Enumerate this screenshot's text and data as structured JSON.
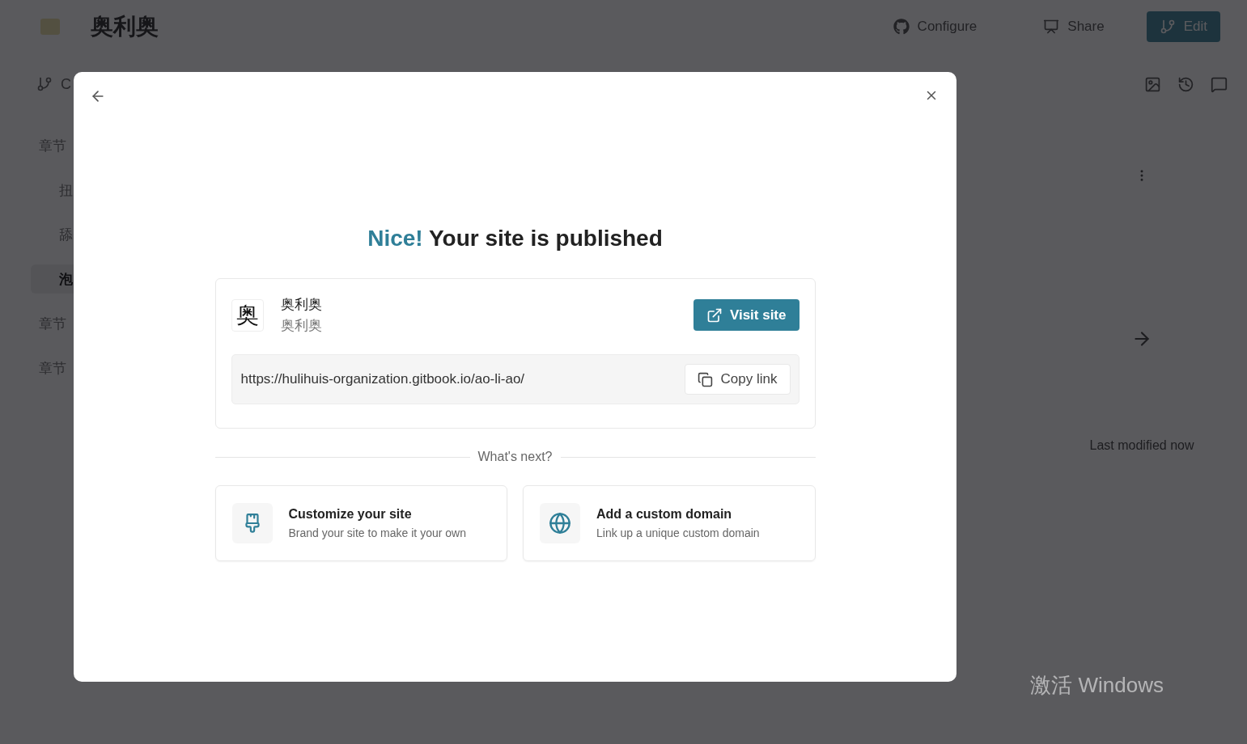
{
  "header": {
    "title": "奥利奥",
    "actions": [
      {
        "kind": "github",
        "label": "Configure"
      },
      {
        "kind": "share",
        "label": "Share"
      },
      {
        "kind": "primary",
        "label": "Edit"
      }
    ]
  },
  "branch": {
    "label": "C"
  },
  "sidebar": {
    "items": [
      {
        "label": "章节",
        "selected": false,
        "children": [
          {
            "label": "扭",
            "selected": false
          },
          {
            "label": "舔",
            "selected": false
          },
          {
            "label": "泡",
            "selected": true
          }
        ]
      },
      {
        "label": "章节",
        "selected": false
      },
      {
        "label": "章节",
        "selected": false
      }
    ]
  },
  "page": {
    "last_modified": "Last modified now"
  },
  "dialog": {
    "title_accent": "Nice!",
    "title": "Your site is published",
    "site": {
      "icon_char": "奥",
      "name": "奥利奥",
      "subtitle": "奥利奥",
      "visit_button": "Visit site",
      "url": "https://hulihuis-organization.gitbook.io/ao-li-ao/",
      "copy_button": "Copy link"
    },
    "next_heading": "What's next?",
    "next_steps": [
      {
        "kind": "customize",
        "title": "Customize your site",
        "description": "Brand your site to make it your own"
      },
      {
        "kind": "domain",
        "title": "Add a custom domain",
        "description": "Link up a unique custom domain"
      }
    ]
  },
  "os_notice": "激活 Windows"
}
